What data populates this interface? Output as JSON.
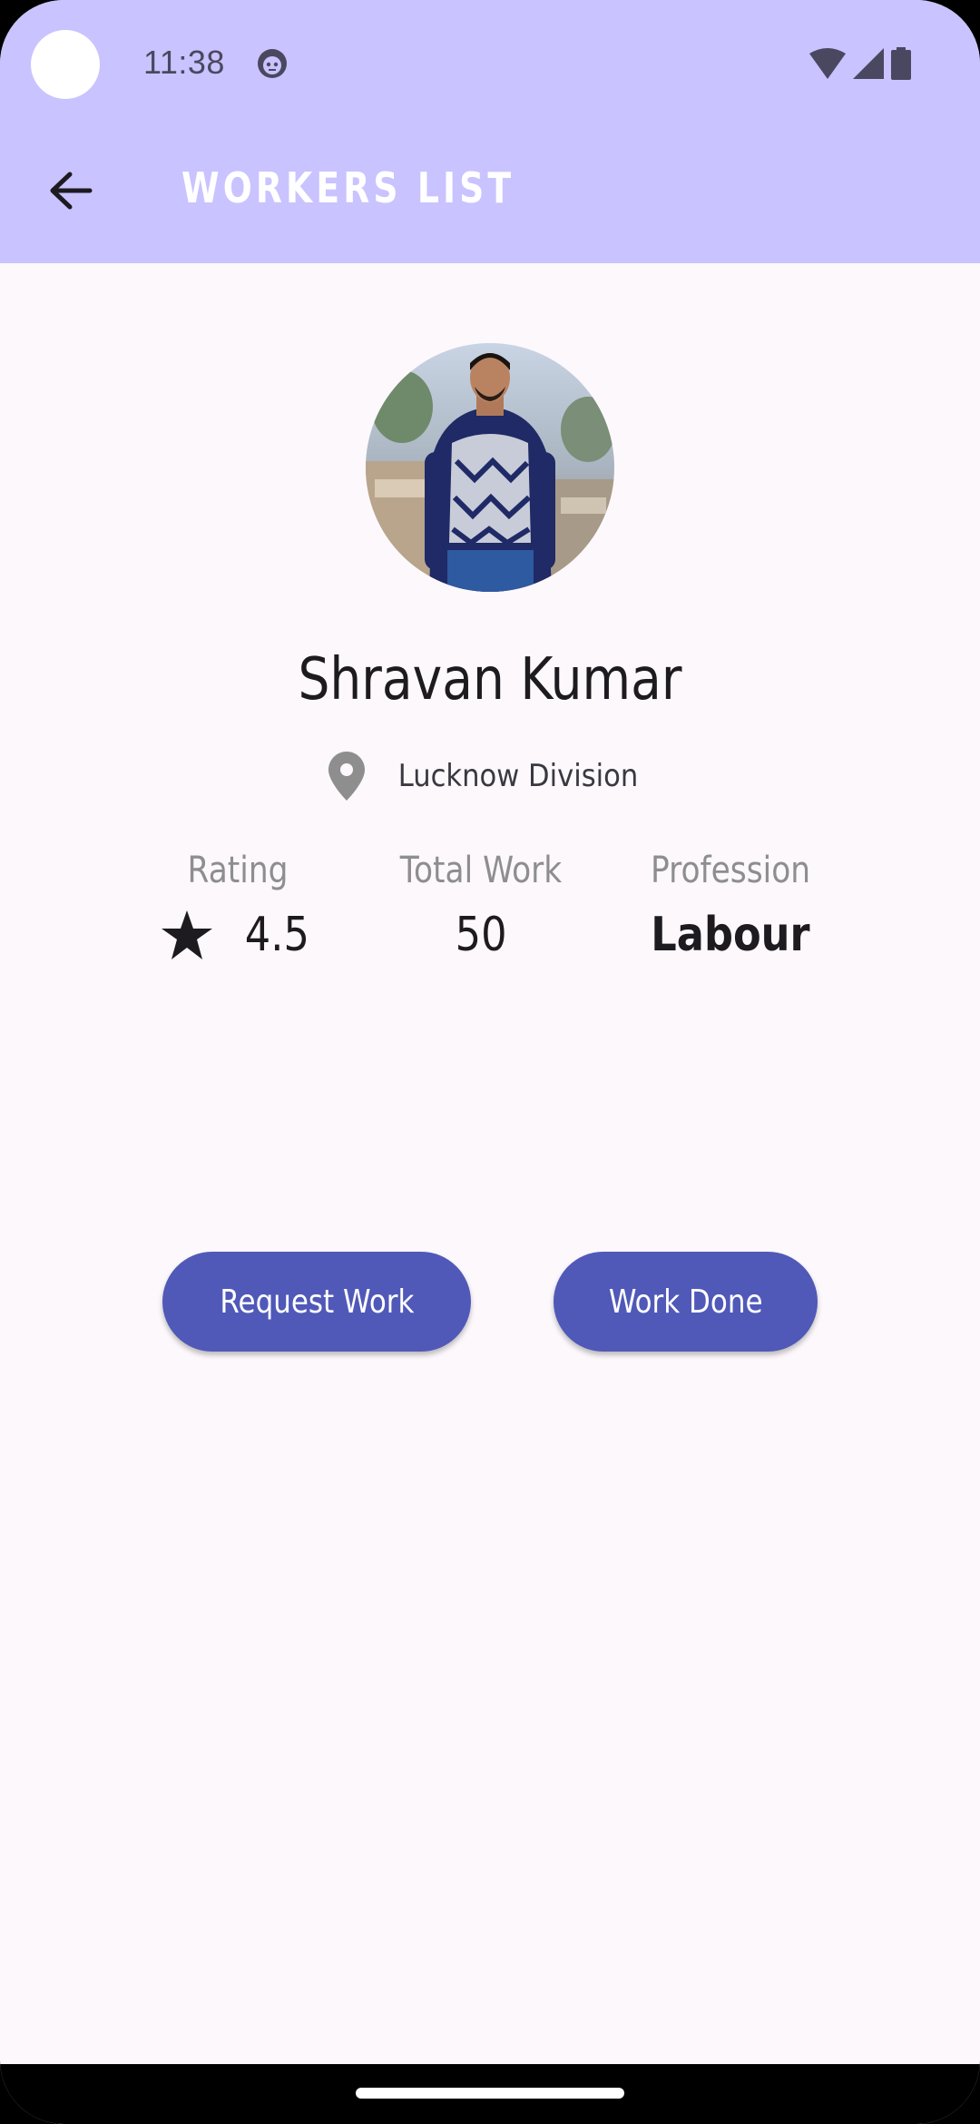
{
  "status_bar": {
    "time": "11:38"
  },
  "toolbar": {
    "title": "WORKERS LIST"
  },
  "worker": {
    "name": "Shravan Kumar",
    "location": "Lucknow Division"
  },
  "stats": {
    "rating_label": "Rating",
    "rating_value": "4.5",
    "total_work_label": "Total Work",
    "total_work_value": "50",
    "profession_label": "Profession",
    "profession_value": "Labour"
  },
  "actions": {
    "request_work_label": "Request Work",
    "work_done_label": "Work Done"
  },
  "colors": {
    "app_bar": "#c9c3ff",
    "background": "#fcf8fc",
    "button": "#5059b8"
  },
  "icons": {
    "back": "arrow-back-icon",
    "location": "location-pin-icon",
    "rating": "star-icon"
  }
}
